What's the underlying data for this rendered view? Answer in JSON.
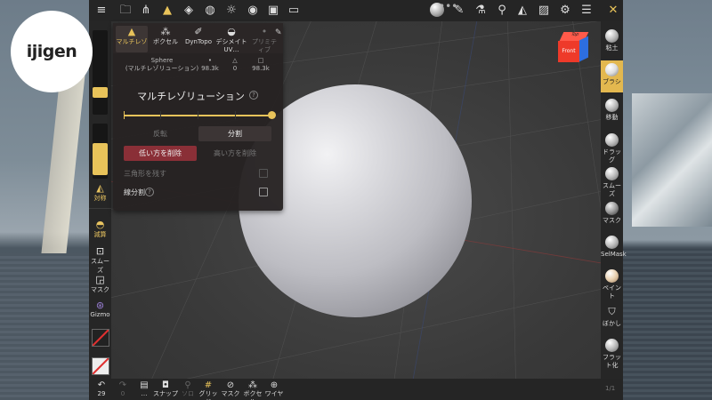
{
  "logo": {
    "text": "ijigen"
  },
  "topbar": {
    "icons": [
      "menu-icon",
      "folder-icon",
      "scene-icon",
      "topology-icon",
      "layers-icon",
      "globe-icon",
      "sun-icon",
      "material-icon",
      "image-icon",
      "video-icon",
      "matcap-icon",
      "brush-icon",
      "picker-icon",
      "paint-icon",
      "symmetry-icon",
      "settings-icon",
      "list-icon",
      "tools-icon"
    ],
    "more": "•••"
  },
  "panel": {
    "tabs": [
      {
        "label": "マルチレゾ",
        "icon": "multires-icon",
        "active": true
      },
      {
        "label": "ボクセル",
        "icon": "voxel-icon"
      },
      {
        "label": "DynTopo",
        "icon": "dyntopo-icon"
      },
      {
        "label": "デシメイトUV…",
        "icon": "decimate-icon"
      },
      {
        "label": "プリミティブ",
        "icon": "primitive-icon",
        "dim": true
      }
    ],
    "object_name": "Sphere",
    "object_sub": "(マルチレゾリューション)",
    "stats": [
      {
        "icon": "•",
        "value": "98.3k"
      },
      {
        "icon": "△",
        "value": "0"
      },
      {
        "icon": "□",
        "value": "98.3k"
      }
    ],
    "title": "マルチレゾリューション",
    "help": "?",
    "reverse_label": "反転",
    "subdivide_label": "分割",
    "delete_low_label": "低い方を削除",
    "delete_high_label": "高い方を削除",
    "keep_triangles_label": "三角形を残す",
    "linear_subdiv_label": "線分割",
    "resolution_level": 1.0
  },
  "left": {
    "symmetry_label": "対称",
    "tools": [
      {
        "label": "減算",
        "icon": "subtract-icon",
        "active": true
      },
      {
        "label": "スムーズ",
        "icon": "smooth-icon"
      },
      {
        "label": "マスク",
        "icon": "mask-icon"
      },
      {
        "label": "Gizmo",
        "icon": "gizmo-icon"
      }
    ]
  },
  "right": {
    "tools": [
      {
        "label": "粘土"
      },
      {
        "label": "ブラシ",
        "active": true
      },
      {
        "label": "移動"
      },
      {
        "label": "ドラッグ"
      },
      {
        "label": "スムーズ"
      },
      {
        "label": "マスク"
      },
      {
        "label": "SelMask"
      },
      {
        "label": "ペイント"
      },
      {
        "label": "ぼかし"
      },
      {
        "label": "フラット化"
      }
    ]
  },
  "viewcube": {
    "top": "Top",
    "front": "Front"
  },
  "bottom": {
    "undo_count": "29",
    "redo_count": "0",
    "items": [
      {
        "label": "…",
        "icon": "file-icon"
      },
      {
        "label": "スナップ",
        "icon": "camera-icon"
      },
      {
        "label": "ソロ",
        "icon": "search-icon",
        "dim": true
      },
      {
        "label": "グリッド",
        "icon": "grid-icon"
      },
      {
        "label": "マスク",
        "icon": "eye-slash-icon"
      },
      {
        "label": "ボクセル",
        "icon": "voxel-icon"
      },
      {
        "label": "ワイヤー",
        "icon": "wire-icon"
      }
    ],
    "corner": "1/1"
  }
}
